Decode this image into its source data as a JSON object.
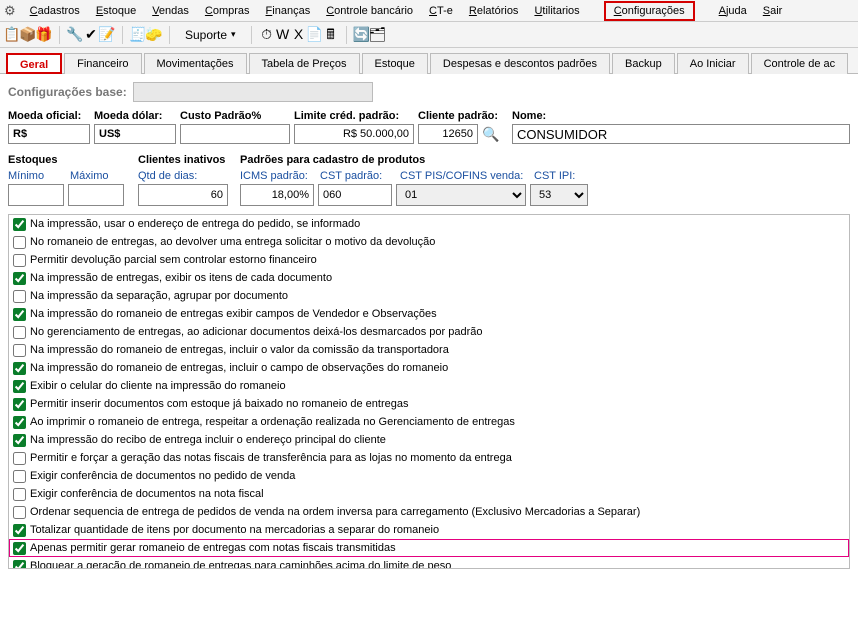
{
  "menubar": {
    "items": [
      "Cadastros",
      "Estoque",
      "Vendas",
      "Compras",
      "Finanças",
      "Controle bancário",
      "CT-e",
      "Relatórios",
      "Utilitarios",
      "Configurações",
      "Ajuda",
      "Sair"
    ],
    "highlighted_index": 9
  },
  "toolbar": {
    "suporte_label": "Suporte",
    "icons_set1": [
      "📋",
      "📦",
      "🎁"
    ],
    "icons_set2": [
      "🔧",
      "✔",
      "📝"
    ],
    "icons_set3": [
      "🧾",
      "🧽"
    ],
    "icons_set4": [
      "⏱",
      "W",
      "X",
      "📄",
      "🖩"
    ],
    "icons_set5": [
      "🔄",
      "🗂"
    ]
  },
  "tabs": {
    "items": [
      "Geral",
      "Financeiro",
      "Movimentações",
      "Tabela de Preços",
      "Estoque",
      "Despesas e descontos padrões",
      "Backup",
      "Ao Iniciar",
      "Controle de ac"
    ],
    "active_index": 0
  },
  "base_config": {
    "label": "Configurações base:"
  },
  "fields": {
    "moeda_oficial": {
      "label": "Moeda oficial:",
      "value": "R$"
    },
    "moeda_dolar": {
      "label": "Moeda dólar:",
      "value": "US$"
    },
    "custo_padrao": {
      "label": "Custo Padrão%",
      "value": ""
    },
    "limite_credito": {
      "label": "Limite créd. padrão:",
      "value": "R$ 50.000,00"
    },
    "cliente_padrao": {
      "label": "Cliente padrão:",
      "value": "12650"
    },
    "nome": {
      "label": "Nome:",
      "value": "CONSUMIDOR"
    }
  },
  "estoques": {
    "title": "Estoques",
    "min_label": "Mínimo",
    "min_value": "",
    "max_label": "Máximo",
    "max_value": ""
  },
  "clientes_inativos": {
    "title": "Clientes inativos",
    "qtd_label": "Qtd de dias:",
    "qtd_value": "60"
  },
  "padroes_produtos": {
    "title": "Padrões para cadastro de produtos",
    "icms_label": "ICMS padrão:",
    "icms_value": "18,00%",
    "cst_label": "CST padrão:",
    "cst_value": "060",
    "piscofins_label": "CST PIS/COFINS venda:",
    "piscofins_value": "01",
    "ipi_label": "CST IPI:",
    "ipi_value": "53"
  },
  "checks": [
    {
      "checked": true,
      "label": "Na impressão, usar o endereço de entrega do pedido, se informado"
    },
    {
      "checked": false,
      "label": "No romaneio de entregas, ao devolver uma entrega solicitar o motivo da devolução"
    },
    {
      "checked": false,
      "label": "Permitir devolução parcial sem controlar estorno financeiro"
    },
    {
      "checked": true,
      "label": "Na impressão de entregas, exibir os itens de cada documento"
    },
    {
      "checked": false,
      "label": "Na impressão da separação, agrupar por documento"
    },
    {
      "checked": true,
      "label": "Na impressão do romaneio de entregas exibir campos de Vendedor e Observações"
    },
    {
      "checked": false,
      "label": "No gerenciamento de entregas, ao adicionar documentos deixá-los desmarcados por padrão"
    },
    {
      "checked": false,
      "label": "Na impressão do romaneio de entregas, incluir o valor da comissão da transportadora"
    },
    {
      "checked": true,
      "label": "Na impressão do romaneio de entregas, incluir o campo de observações do romaneio"
    },
    {
      "checked": true,
      "label": "Exibir o celular do cliente na impressão do romaneio"
    },
    {
      "checked": true,
      "label": "Permitir inserir documentos com estoque já baixado no romaneio de entregas"
    },
    {
      "checked": true,
      "label": "Ao imprimir o romaneio de entrega, respeitar a ordenação realizada no Gerenciamento de entregas"
    },
    {
      "checked": true,
      "label": "Na impressão do recibo de entrega incluir o endereço principal do cliente"
    },
    {
      "checked": false,
      "label": "Permitir e forçar a geração das notas fiscais de transferência para as lojas no momento da entrega"
    },
    {
      "checked": false,
      "label": "Exigir conferência de documentos no pedido de venda"
    },
    {
      "checked": false,
      "label": "Exigir conferência de documentos na nota fiscal"
    },
    {
      "checked": false,
      "label": "Ordenar sequencia de entrega de pedidos de venda na ordem inversa para carregamento (Exclusivo Mercadorias a Separar)"
    },
    {
      "checked": true,
      "label": "Totalizar quantidade de itens por documento na mercadorias a separar do romaneio"
    },
    {
      "checked": true,
      "label": "Apenas permitir gerar romaneio de entregas com notas fiscais transmitidas",
      "highlight": true
    },
    {
      "checked": true,
      "label": "Bloquear a geração de romaneio de entregas para caminhões acima do limite de peso"
    }
  ]
}
